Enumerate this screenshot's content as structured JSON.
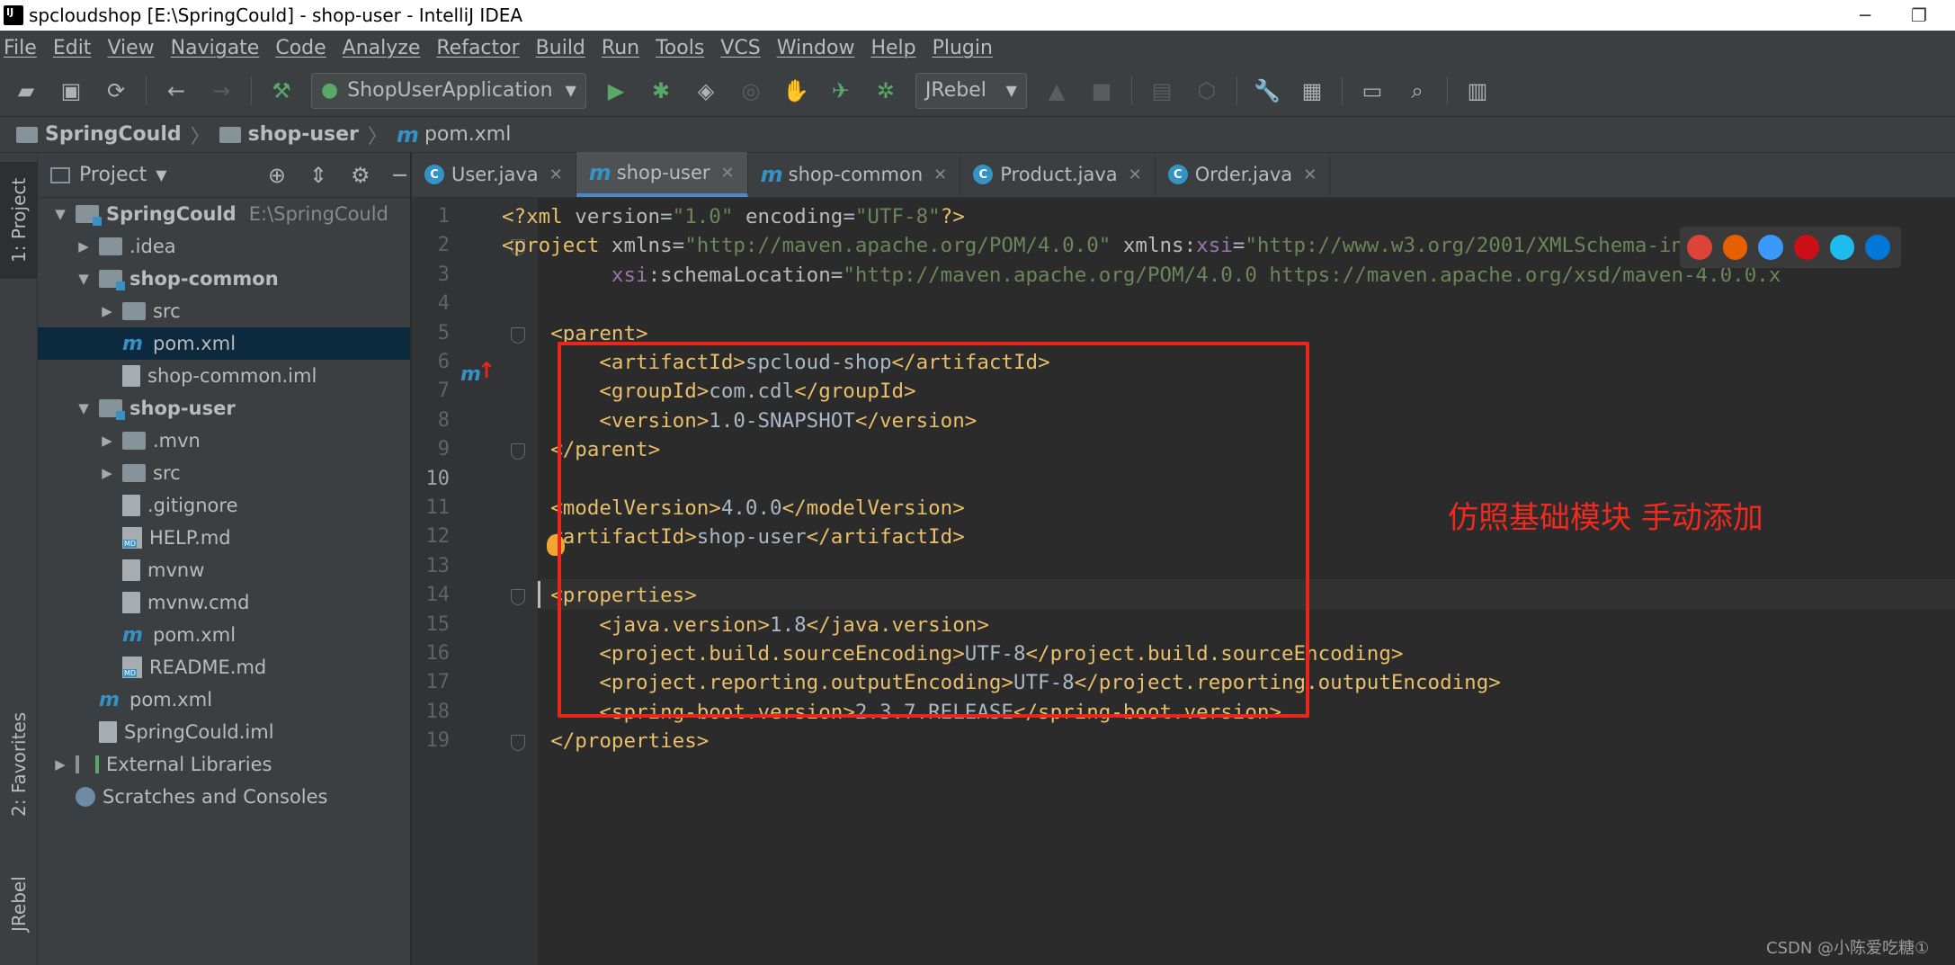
{
  "window": {
    "title": "spcloudshop [E:\\SpringCould] - shop-user - IntelliJ IDEA",
    "minimize": "─",
    "restore": "❐"
  },
  "menu": [
    "File",
    "Edit",
    "View",
    "Navigate",
    "Code",
    "Analyze",
    "Refactor",
    "Build",
    "Run",
    "Tools",
    "VCS",
    "Window",
    "Help",
    "Plugin"
  ],
  "toolbar": {
    "run_config": "ShopUserApplication",
    "jrebel_label": "JRebel"
  },
  "breadcrumb": {
    "items": [
      "SpringCould",
      "shop-user",
      "pom.xml"
    ]
  },
  "side_tabs": {
    "project": "1: Project",
    "favorites": "2: Favorites",
    "jrebel": "JRebel"
  },
  "project_panel": {
    "header": "Project",
    "tree": [
      {
        "label": "SpringCould",
        "extra": "E:\\SpringCould",
        "level": 0,
        "expanded": true,
        "icon": "module-folder-icon",
        "bold": true
      },
      {
        "label": ".idea",
        "level": 1,
        "expanded": false,
        "icon": "folder-icon"
      },
      {
        "label": "shop-common",
        "level": 1,
        "expanded": true,
        "icon": "module-folder-icon",
        "bold": true
      },
      {
        "label": "src",
        "level": 2,
        "expanded": false,
        "icon": "folder-icon"
      },
      {
        "label": "pom.xml",
        "level": 2,
        "icon": "maven-icon",
        "selected": true
      },
      {
        "label": "shop-common.iml",
        "level": 2,
        "icon": "iml-file-icon"
      },
      {
        "label": "shop-user",
        "level": 1,
        "expanded": true,
        "icon": "module-folder-icon",
        "bold": true
      },
      {
        "label": ".mvn",
        "level": 2,
        "expanded": false,
        "icon": "folder-icon"
      },
      {
        "label": "src",
        "level": 2,
        "expanded": false,
        "icon": "folder-icon"
      },
      {
        "label": ".gitignore",
        "level": 2,
        "icon": "file-icon"
      },
      {
        "label": "HELP.md",
        "level": 2,
        "icon": "markdown-icon"
      },
      {
        "label": "mvnw",
        "level": 2,
        "icon": "file-icon"
      },
      {
        "label": "mvnw.cmd",
        "level": 2,
        "icon": "file-icon"
      },
      {
        "label": "pom.xml",
        "level": 2,
        "icon": "maven-icon"
      },
      {
        "label": "README.md",
        "level": 2,
        "icon": "markdown-icon"
      },
      {
        "label": "pom.xml",
        "level": 1,
        "icon": "maven-icon"
      },
      {
        "label": "SpringCould.iml",
        "level": 1,
        "icon": "iml-file-icon"
      },
      {
        "label": "External Libraries",
        "level": 0,
        "expanded": false,
        "icon": "libraries-icon"
      },
      {
        "label": "Scratches and Consoles",
        "level": 0,
        "icon": "scratches-icon"
      }
    ]
  },
  "tabs": [
    {
      "label": "User.java",
      "icon": "class-icon",
      "active": false
    },
    {
      "label": "shop-user",
      "icon": "maven-icon",
      "active": true
    },
    {
      "label": "shop-common",
      "icon": "maven-icon",
      "active": false
    },
    {
      "label": "Product.java",
      "icon": "class-icon",
      "active": false
    },
    {
      "label": "Order.java",
      "icon": "class-icon",
      "active": false
    }
  ],
  "editor": {
    "current_line": 10,
    "line_numbers": [
      "1",
      "2",
      "3",
      "4",
      "5",
      "6",
      "7",
      "8",
      "9",
      "10",
      "11",
      "12",
      "13",
      "14",
      "15",
      "16",
      "17",
      "18",
      "19"
    ],
    "lines": [
      "<?xml version=\"1.0\" encoding=\"UTF-8\"?>",
      "<project xmlns=\"http://maven.apache.org/POM/4.0.0\" xmlns:xsi=\"http://www.w3.org/2001/XMLSchema-instance\"",
      "         xsi:schemaLocation=\"http://maven.apache.org/POM/4.0.0 https://maven.apache.org/xsd/maven-4.0.0.x",
      "",
      "    <parent>",
      "        <artifactId>spcloud-shop</artifactId>",
      "        <groupId>com.cdl</groupId>",
      "        <version>1.0-SNAPSHOT</version>",
      "    </parent>",
      "",
      "    <modelVersion>4.0.0</modelVersion>",
      "    <artifactId>shop-user</artifactId>",
      "",
      "    <properties>",
      "        <java.version>1.8</java.version>",
      "        <project.build.sourceEncoding>UTF-8</project.build.sourceEncoding>",
      "        <project.reporting.outputEncoding>UTF-8</project.reporting.outputEncoding>",
      "        <spring-boot.version>2.3.7.RELEASE</spring-boot.version>",
      "    </properties>"
    ]
  },
  "annotation": {
    "text": "仿照基础模块 手动添加",
    "color": "#f02a1f",
    "box_color": "#e8261e"
  },
  "watermark": "CSDN @小陈爱吃糖①",
  "colors": {
    "tag": "#e8bf6a",
    "string": "#6a8759",
    "namespace": "#9876aa",
    "text": "#a9b7c6",
    "accent": "#4a88c7"
  }
}
